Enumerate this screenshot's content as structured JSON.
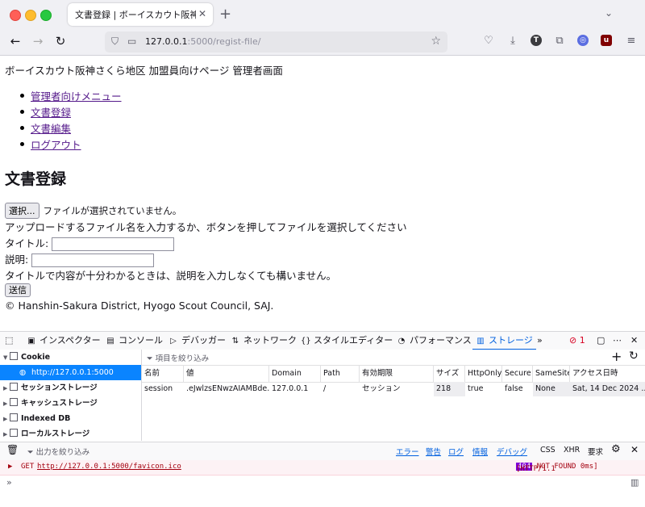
{
  "browser": {
    "tab_title": "文書登録 | ボーイスカウト阪神さくら",
    "url_host": "127.0.0.1",
    "url_path": ":5000/regist-file/"
  },
  "page": {
    "site_title": "ボーイスカウト阪神さくら地区 加盟員向けページ 管理者画面",
    "menu": [
      "管理者向けメニュー",
      "文書登録",
      "文書編集",
      "ログアウト"
    ],
    "heading": "文書登録",
    "file_button": "選択...",
    "file_status": "ファイルが選択されていません。",
    "upload_hint": "アップロードするファイル名を入力するか、ボタンを押してファイルを選択してください",
    "title_label": "タイトル:",
    "desc_label": "説明:",
    "desc_hint": "タイトルで内容が十分わかるときは、説明を入力しなくても構いません。",
    "submit": "送信",
    "footer": "© Hanshin-Sakura District, Hyogo Scout Council, SAJ."
  },
  "devtools": {
    "tabs": [
      "インスペクター",
      "コンソール",
      "デバッガー",
      "ネットワーク",
      "スタイルエディター",
      "パフォーマンス",
      "ストレージ"
    ],
    "error_count": "1",
    "sidebar": [
      "Cookie",
      "http://127.0.0.1:5000",
      "セッションストレージ",
      "キャッシュストレージ",
      "Indexed DB",
      "ローカルストレージ"
    ],
    "filter_placeholder": "項目を絞り込み",
    "columns": [
      "名前",
      "値",
      "Domain",
      "Path",
      "有効期限",
      "サイズ",
      "HttpOnly",
      "Secure",
      "SameSite",
      "アクセス日時"
    ],
    "row": [
      "session",
      ".eJwlzsENwzAIAMBde...",
      "127.0.0.1",
      "/",
      "セッション",
      "218",
      "true",
      "false",
      "None",
      "Sat, 14 Dec 2024 ..."
    ],
    "console_filter": "出力を絞り込み",
    "console_levels": [
      "エラー",
      "警告",
      "ログ",
      "情報",
      "デバッグ"
    ],
    "console_extras": [
      "CSS",
      "XHR",
      "要求"
    ],
    "console_method": "GET",
    "console_url": "http://127.0.0.1:5000/favicon.ico",
    "console_status_prefix": "[HTTP/1.1",
    "console_status_code": "404",
    "console_status_suffix": "NOT FOUND 0ms]"
  }
}
